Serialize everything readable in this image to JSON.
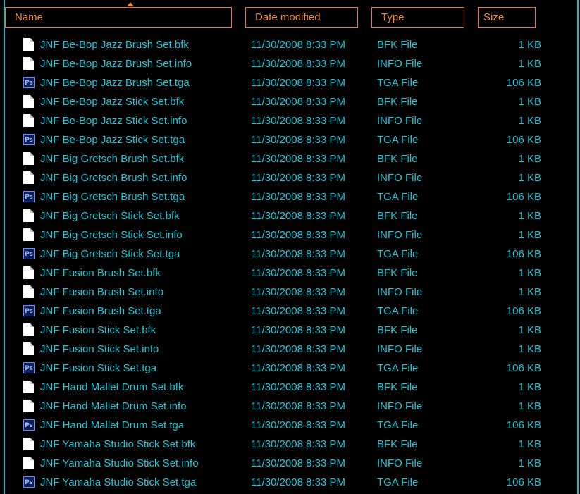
{
  "columns": {
    "name": "Name",
    "date": "Date modified",
    "type": "Type",
    "size": "Size"
  },
  "icons": {
    "file": "document-icon",
    "tga": "photoshop-icon"
  },
  "colors": {
    "accent_text": "#1ec8d8",
    "header_text": "#f08a2e",
    "background": "#000000"
  },
  "files": [
    {
      "icon": "file",
      "name": "JNF Be-Bop Jazz Brush Set.bfk",
      "date": "11/30/2008 8:33 PM",
      "type": "BFK File",
      "size": "1 KB"
    },
    {
      "icon": "file",
      "name": "JNF Be-Bop Jazz Brush Set.info",
      "date": "11/30/2008 8:33 PM",
      "type": "INFO File",
      "size": "1 KB"
    },
    {
      "icon": "ps",
      "name": "JNF Be-Bop Jazz Brush Set.tga",
      "date": "11/30/2008 8:33 PM",
      "type": "TGA File",
      "size": "106 KB"
    },
    {
      "icon": "file",
      "name": "JNF Be-Bop Jazz Stick Set.bfk",
      "date": "11/30/2008 8:33 PM",
      "type": "BFK File",
      "size": "1 KB"
    },
    {
      "icon": "file",
      "name": "JNF Be-Bop Jazz Stick Set.info",
      "date": "11/30/2008 8:33 PM",
      "type": "INFO File",
      "size": "1 KB"
    },
    {
      "icon": "ps",
      "name": "JNF Be-Bop Jazz Stick Set.tga",
      "date": "11/30/2008 8:33 PM",
      "type": "TGA File",
      "size": "106 KB"
    },
    {
      "icon": "file",
      "name": "JNF Big Gretsch Brush Set.bfk",
      "date": "11/30/2008 8:33 PM",
      "type": "BFK File",
      "size": "1 KB"
    },
    {
      "icon": "file",
      "name": "JNF Big Gretsch Brush Set.info",
      "date": "11/30/2008 8:33 PM",
      "type": "INFO File",
      "size": "1 KB"
    },
    {
      "icon": "ps",
      "name": "JNF Big Gretsch Brush Set.tga",
      "date": "11/30/2008 8:33 PM",
      "type": "TGA File",
      "size": "106 KB"
    },
    {
      "icon": "file",
      "name": "JNF Big Gretsch Stick Set.bfk",
      "date": "11/30/2008 8:33 PM",
      "type": "BFK File",
      "size": "1 KB"
    },
    {
      "icon": "file",
      "name": "JNF Big Gretsch Stick Set.info",
      "date": "11/30/2008 8:33 PM",
      "type": "INFO File",
      "size": "1 KB"
    },
    {
      "icon": "ps",
      "name": "JNF Big Gretsch Stick Set.tga",
      "date": "11/30/2008 8:33 PM",
      "type": "TGA File",
      "size": "106 KB"
    },
    {
      "icon": "file",
      "name": "JNF Fusion Brush Set.bfk",
      "date": "11/30/2008 8:33 PM",
      "type": "BFK File",
      "size": "1 KB"
    },
    {
      "icon": "file",
      "name": "JNF Fusion Brush Set.info",
      "date": "11/30/2008 8:33 PM",
      "type": "INFO File",
      "size": "1 KB"
    },
    {
      "icon": "ps",
      "name": "JNF Fusion Brush Set.tga",
      "date": "11/30/2008 8:33 PM",
      "type": "TGA File",
      "size": "106 KB"
    },
    {
      "icon": "file",
      "name": "JNF Fusion Stick Set.bfk",
      "date": "11/30/2008 8:33 PM",
      "type": "BFK File",
      "size": "1 KB"
    },
    {
      "icon": "file",
      "name": "JNF Fusion Stick Set.info",
      "date": "11/30/2008 8:33 PM",
      "type": "INFO File",
      "size": "1 KB"
    },
    {
      "icon": "ps",
      "name": "JNF Fusion Stick Set.tga",
      "date": "11/30/2008 8:33 PM",
      "type": "TGA File",
      "size": "106 KB"
    },
    {
      "icon": "file",
      "name": "JNF Hand Mallet Drum Set.bfk",
      "date": "11/30/2008 8:33 PM",
      "type": "BFK File",
      "size": "1 KB"
    },
    {
      "icon": "file",
      "name": "JNF Hand Mallet Drum Set.info",
      "date": "11/30/2008 8:33 PM",
      "type": "INFO File",
      "size": "1 KB"
    },
    {
      "icon": "ps",
      "name": "JNF Hand Mallet Drum Set.tga",
      "date": "11/30/2008 8:33 PM",
      "type": "TGA File",
      "size": "106 KB"
    },
    {
      "icon": "file",
      "name": "JNF Yamaha Studio Stick Set.bfk",
      "date": "11/30/2008 8:33 PM",
      "type": "BFK File",
      "size": "1 KB"
    },
    {
      "icon": "file",
      "name": "JNF Yamaha Studio Stick Set.info",
      "date": "11/30/2008 8:33 PM",
      "type": "INFO File",
      "size": "1 KB"
    },
    {
      "icon": "ps",
      "name": "JNF Yamaha Studio Stick Set.tga",
      "date": "11/30/2008 8:33 PM",
      "type": "TGA File",
      "size": "106 KB"
    }
  ]
}
